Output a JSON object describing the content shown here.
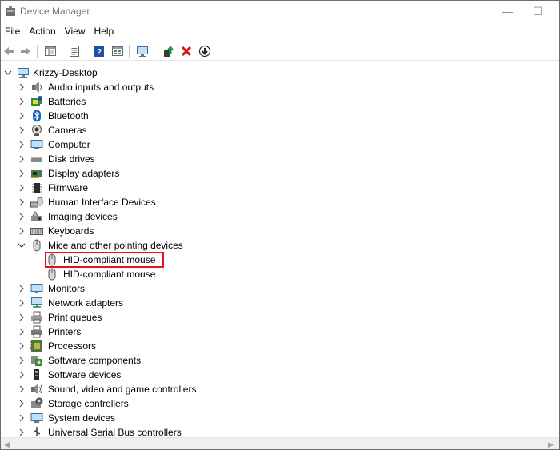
{
  "window": {
    "title": "Device Manager",
    "controls": {
      "minimize": "—",
      "maximize": "☐"
    }
  },
  "menu": [
    "File",
    "Action",
    "View",
    "Help"
  ],
  "toolbar": [
    {
      "name": "back-arrow-icon"
    },
    {
      "name": "forward-arrow-icon"
    },
    {
      "name": "show-hide-console-tree-icon"
    },
    {
      "name": "properties-icon"
    },
    {
      "name": "help-icon"
    },
    {
      "name": "view-icon"
    },
    {
      "name": "scan-hardware-icon"
    },
    {
      "name": "update-driver-icon"
    },
    {
      "name": "uninstall-device-icon"
    },
    {
      "name": "disable-device-icon"
    }
  ],
  "tree": {
    "root": "Krizzy-Desktop",
    "categories": [
      {
        "label": "Audio inputs and outputs",
        "icon": "speaker-icon",
        "expanded": false
      },
      {
        "label": "Batteries",
        "icon": "battery-icon",
        "expanded": false
      },
      {
        "label": "Bluetooth",
        "icon": "bluetooth-icon",
        "expanded": false
      },
      {
        "label": "Cameras",
        "icon": "camera-icon",
        "expanded": false
      },
      {
        "label": "Computer",
        "icon": "computer-icon",
        "expanded": false
      },
      {
        "label": "Disk drives",
        "icon": "disk-drive-icon",
        "expanded": false
      },
      {
        "label": "Display adapters",
        "icon": "display-adapter-icon",
        "expanded": false
      },
      {
        "label": "Firmware",
        "icon": "firmware-icon",
        "expanded": false
      },
      {
        "label": "Human Interface Devices",
        "icon": "hid-icon",
        "expanded": false
      },
      {
        "label": "Imaging devices",
        "icon": "imaging-icon",
        "expanded": false
      },
      {
        "label": "Keyboards",
        "icon": "keyboard-icon",
        "expanded": false
      },
      {
        "label": "Mice and other pointing devices",
        "icon": "mouse-icon",
        "expanded": true,
        "children": [
          "HID-compliant mouse",
          "HID-compliant mouse"
        ]
      },
      {
        "label": "Monitors",
        "icon": "monitor-icon",
        "expanded": false
      },
      {
        "label": "Network adapters",
        "icon": "network-icon",
        "expanded": false
      },
      {
        "label": "Print queues",
        "icon": "print-queue-icon",
        "expanded": false
      },
      {
        "label": "Printers",
        "icon": "printer-icon",
        "expanded": false
      },
      {
        "label": "Processors",
        "icon": "processor-icon",
        "expanded": false
      },
      {
        "label": "Software components",
        "icon": "software-component-icon",
        "expanded": false
      },
      {
        "label": "Software devices",
        "icon": "software-device-icon",
        "expanded": false
      },
      {
        "label": "Sound, video and game controllers",
        "icon": "sound-icon",
        "expanded": false
      },
      {
        "label": "Storage controllers",
        "icon": "storage-icon",
        "expanded": false
      },
      {
        "label": "System devices",
        "icon": "system-icon",
        "expanded": false
      },
      {
        "label": "Universal Serial Bus controllers",
        "icon": "usb-icon",
        "expanded": false
      }
    ]
  },
  "colors": {
    "highlight": "#e8101c",
    "uninstall": "#d41818",
    "update": "#1a9e3a",
    "help": "#1f4fa8"
  }
}
